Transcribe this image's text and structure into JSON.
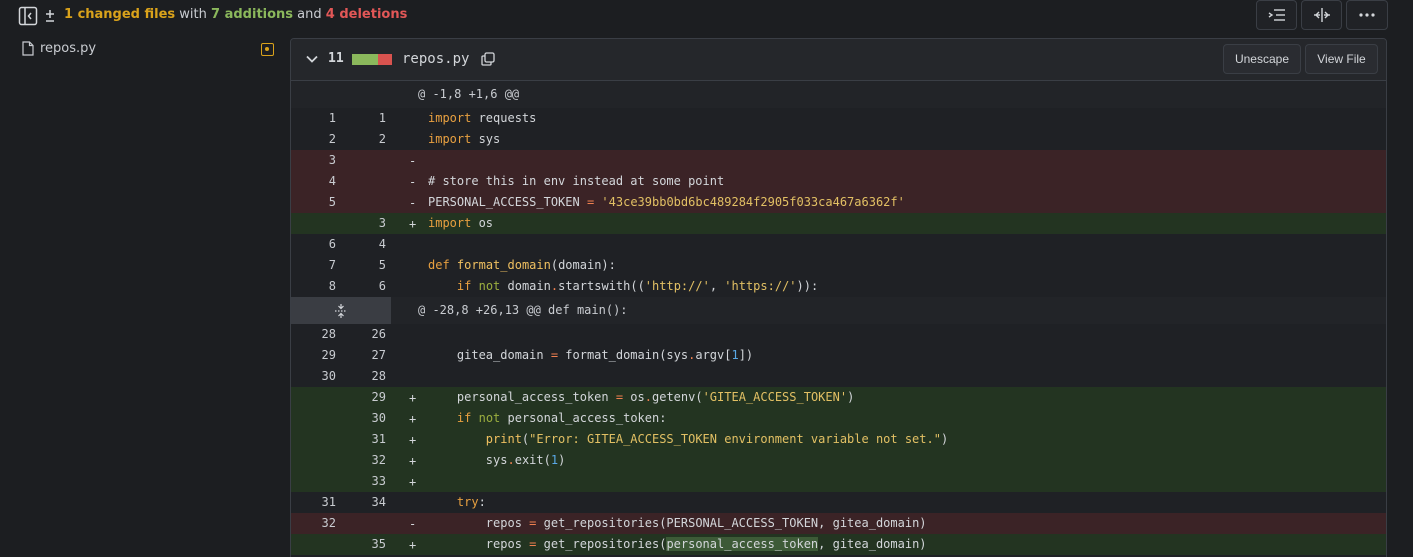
{
  "summary": {
    "changed": "1 changed files",
    "with": " with ",
    "additions": "7 additions",
    "and": " and ",
    "deletions": "4 deletions"
  },
  "sidebar": {
    "file": "repos.py"
  },
  "file_header": {
    "count": "11",
    "filename": "repos.py",
    "unescape_label": "Unescape",
    "view_file_label": "View File"
  },
  "hunks": [
    "@ -1,8 +1,6 @@",
    "@ -28,8 +26,13 @@ def main():"
  ],
  "lines": [
    {
      "old": "1",
      "new": "1",
      "mark": "",
      "type": "ctx"
    },
    {
      "old": "2",
      "new": "2",
      "mark": "",
      "type": "ctx"
    },
    {
      "old": "3",
      "new": "",
      "mark": "-",
      "type": "del"
    },
    {
      "old": "4",
      "new": "",
      "mark": "-",
      "type": "del"
    },
    {
      "old": "5",
      "new": "",
      "mark": "-",
      "type": "del"
    },
    {
      "old": "",
      "new": "3",
      "mark": "+",
      "type": "add"
    },
    {
      "old": "6",
      "new": "4",
      "mark": "",
      "type": "ctx"
    },
    {
      "old": "7",
      "new": "5",
      "mark": "",
      "type": "ctx"
    },
    {
      "old": "8",
      "new": "6",
      "mark": "",
      "type": "ctx"
    },
    {
      "old": "28",
      "new": "26",
      "mark": "",
      "type": "ctx"
    },
    {
      "old": "29",
      "new": "27",
      "mark": "",
      "type": "ctx"
    },
    {
      "old": "30",
      "new": "28",
      "mark": "",
      "type": "ctx"
    },
    {
      "old": "",
      "new": "29",
      "mark": "+",
      "type": "add"
    },
    {
      "old": "",
      "new": "30",
      "mark": "+",
      "type": "add"
    },
    {
      "old": "",
      "new": "31",
      "mark": "+",
      "type": "add"
    },
    {
      "old": "",
      "new": "32",
      "mark": "+",
      "type": "add"
    },
    {
      "old": "",
      "new": "33",
      "mark": "+",
      "type": "add"
    },
    {
      "old": "31",
      "new": "34",
      "mark": "",
      "type": "ctx"
    },
    {
      "old": "32",
      "new": "",
      "mark": "-",
      "type": "del"
    },
    {
      "old": "",
      "new": "35",
      "mark": "+",
      "type": "add"
    }
  ],
  "code": {
    "l0": [
      "import",
      " requests"
    ],
    "l1": [
      "import",
      " sys"
    ],
    "l3": "# store this in env instead at some point",
    "l4": [
      "PERSONAL_ACCESS_TOKEN ",
      "=",
      " ",
      "'43ce39bb0bd6bc489284f2905f033ca467a6362f'"
    ],
    "l5": [
      "import",
      " os"
    ],
    "l7": [
      "def",
      " ",
      "format_domain",
      "(domain):"
    ],
    "l8": [
      "    ",
      "if",
      " ",
      "not",
      " domain",
      ".",
      "startswith((",
      "'http://'",
      ", ",
      "'https://'",
      ")):"
    ],
    "l10": [
      "    gitea_domain ",
      "=",
      " format_domain(sys",
      ".",
      "argv[",
      "1",
      "])"
    ],
    "l12": [
      "    personal_access_token ",
      "=",
      " os",
      ".",
      "getenv(",
      "'GITEA_ACCESS_TOKEN'",
      ")"
    ],
    "l13": [
      "    ",
      "if",
      " ",
      "not",
      " personal_access_token:"
    ],
    "l14": [
      "        ",
      "print",
      "(",
      "\"Error: GITEA_ACCESS_TOKEN environment variable not set.\"",
      ")"
    ],
    "l15": [
      "        sys",
      ".",
      "exit(",
      "1",
      ")"
    ],
    "l17": [
      "    ",
      "try",
      ":"
    ],
    "l18": [
      "        repos ",
      "=",
      " get_repositories(PERSONAL_ACCESS_TOKEN, gitea_domain)"
    ],
    "l19": [
      "        repos ",
      "=",
      " get_repositories(",
      "personal_access_token",
      ", gitea_domain)"
    ]
  },
  "colors": {
    "added_bg": "#233421",
    "deleted_bg": "#3b2326",
    "accent_yellow": "#d9a21b",
    "add_green": "#8bb85c",
    "del_red": "#e25757"
  }
}
